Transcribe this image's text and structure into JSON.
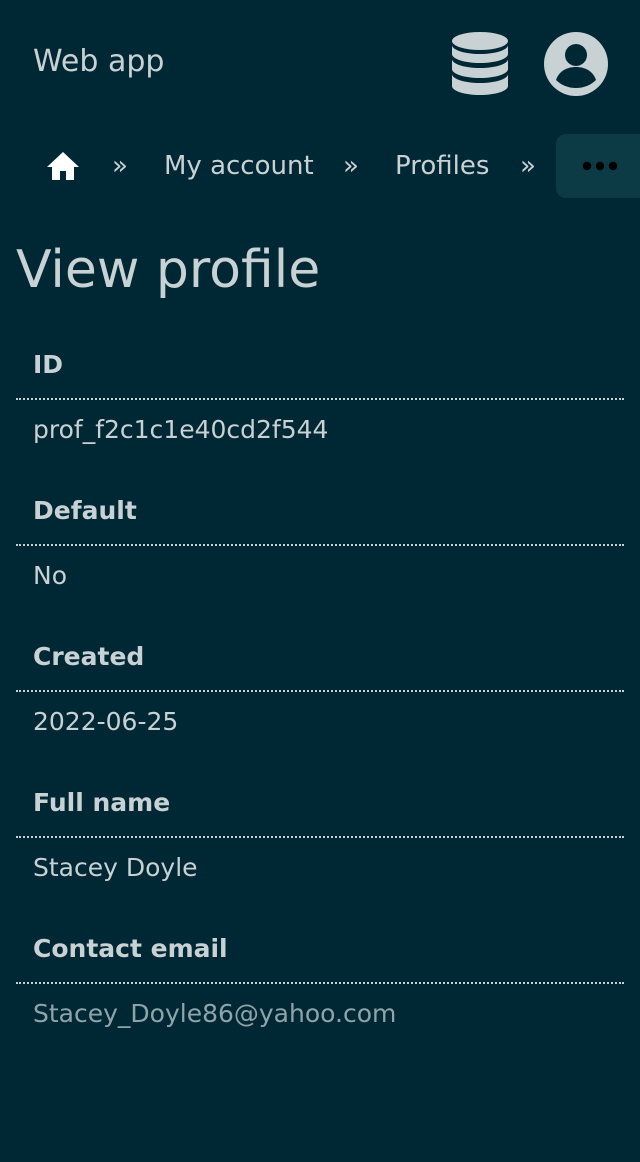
{
  "header": {
    "app_title": "Web app",
    "db_icon": "database-icon",
    "user_icon": "user-circle-icon"
  },
  "breadcrumb": {
    "home_icon": "home-icon",
    "separator": "»",
    "items": [
      "My account",
      "Profiles"
    ],
    "more_icon": "ellipsis-icon"
  },
  "page": {
    "title": "View profile"
  },
  "fields": [
    {
      "label": "ID",
      "value": "prof_f2c1c1e40cd2f544"
    },
    {
      "label": "Default",
      "value": "No"
    },
    {
      "label": "Created",
      "value": "2022-06-25"
    },
    {
      "label": "Full name",
      "value": "Stacey Doyle"
    },
    {
      "label": "Contact email",
      "value": "Stacey_Doyle86@yahoo.com"
    }
  ],
  "colors": {
    "background": "#002834",
    "text": "#c8d1d4",
    "link": "#8ea4ab"
  }
}
